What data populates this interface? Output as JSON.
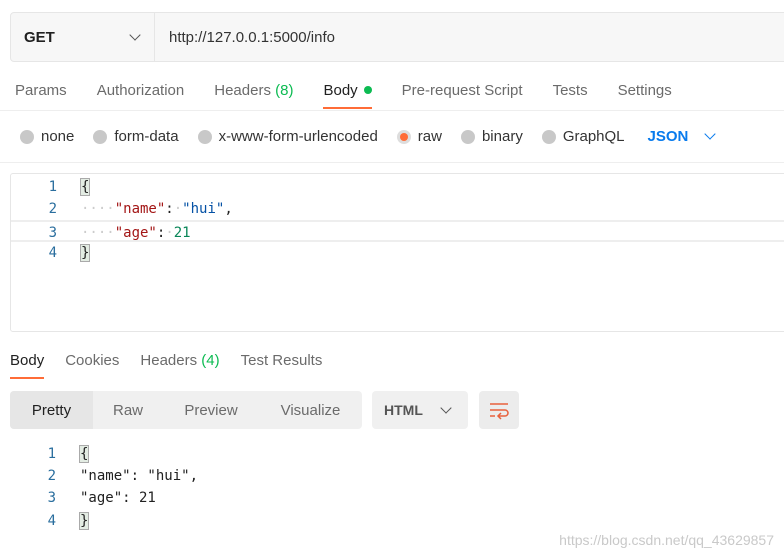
{
  "request": {
    "method": "GET",
    "url": "http://127.0.0.1:5000/info"
  },
  "tabs": [
    {
      "label": "Params"
    },
    {
      "label": "Authorization"
    },
    {
      "label": "Headers",
      "count": "(8)"
    },
    {
      "label": "Body"
    },
    {
      "label": "Pre-request Script"
    },
    {
      "label": "Tests"
    },
    {
      "label": "Settings"
    }
  ],
  "body_types": [
    "none",
    "form-data",
    "x-www-form-urlencoded",
    "raw",
    "binary",
    "GraphQL"
  ],
  "selected_body_type": "raw",
  "language": "JSON",
  "editor": {
    "line_numbers": [
      "1",
      "2",
      "3",
      "4"
    ],
    "open": "{",
    "close": "}",
    "key1": "\"name\"",
    "val1": "\"hui\"",
    "key2": "\"age\"",
    "val2": "21"
  },
  "response_tabs": [
    {
      "label": "Body"
    },
    {
      "label": "Cookies"
    },
    {
      "label": "Headers",
      "count": "(4)"
    },
    {
      "label": "Test Results"
    }
  ],
  "format_buttons": [
    "Pretty",
    "Raw",
    "Preview",
    "Visualize"
  ],
  "response_format": "HTML",
  "response": {
    "line_numbers": [
      "1",
      "2",
      "3",
      "4"
    ],
    "lines": [
      "{",
      "\"name\": \"hui\",",
      "\"age\": 21",
      "}"
    ]
  },
  "watermark": "https://blog.csdn.net/qq_43629857",
  "colors": {
    "accent": "#ff6c37",
    "green": "#0cbb52",
    "json_blue": "#097bed"
  }
}
